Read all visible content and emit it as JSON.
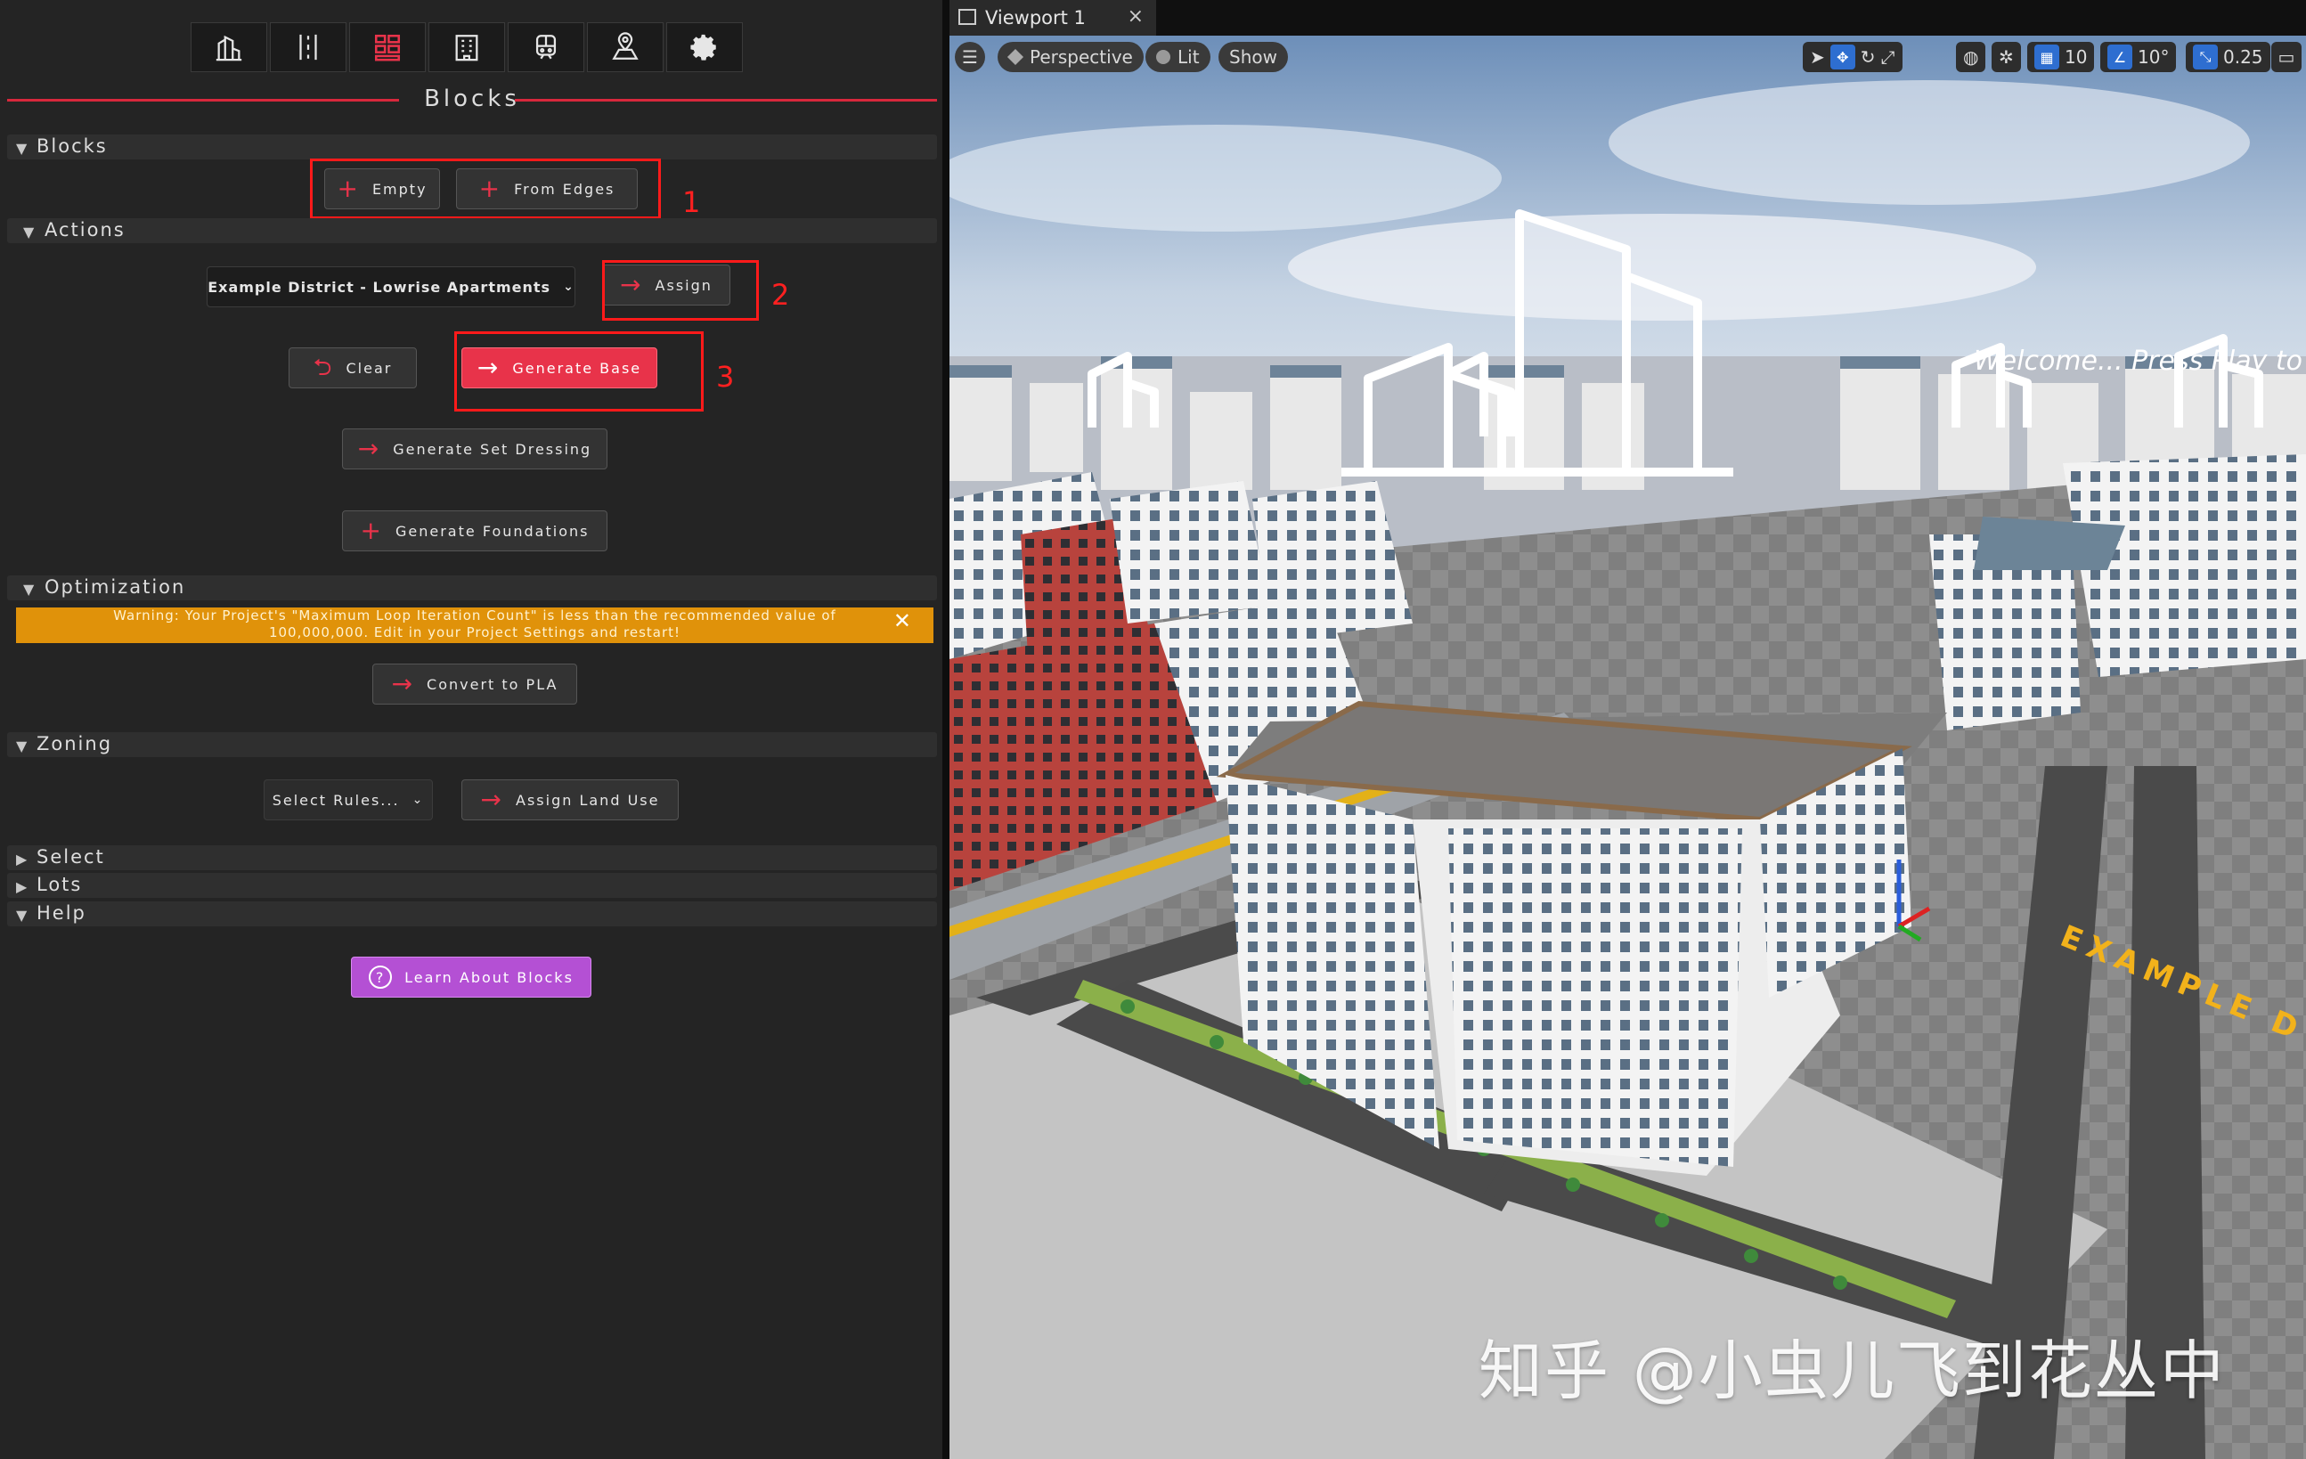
{
  "toolbar": {
    "icons": [
      "buildings-icon",
      "road-icon",
      "blocks-icon",
      "building-icon",
      "transit-icon",
      "map-icon",
      "gear-icon"
    ],
    "active_index": 2
  },
  "panel_title": "Blocks",
  "sections": {
    "blocks": "Blocks",
    "actions": "Actions",
    "optimization": "Optimization",
    "zoning": "Zoning",
    "select": "Select",
    "lots": "Lots",
    "help": "Help"
  },
  "buttons": {
    "empty": "Empty",
    "from_edges": "From Edges",
    "district_dropdown": "Example District - Lowrise Apartments",
    "assign": "Assign",
    "clear": "Clear",
    "generate_base": "Generate Base",
    "generate_set_dressing": "Generate Set Dressing",
    "generate_foundations": "Generate Foundations",
    "convert_to_pla": "Convert to PLA",
    "select_rules": "Select Rules...",
    "assign_land_use": "Assign Land Use",
    "learn_about_blocks": "Learn About Blocks"
  },
  "annotations": [
    "1",
    "2",
    "3"
  ],
  "warning": {
    "line1": "Warning: Your Project's \"Maximum Loop Iteration Count\" is less than the recommended value of",
    "line2": "100,000,000. Edit in your Project Settings and restart!"
  },
  "viewport": {
    "tab_title": "Viewport 1",
    "perspective": "Perspective",
    "lit": "Lit",
    "show": "Show",
    "grid_snap": "10",
    "rotation_snap": "10°",
    "scale_snap": "0.25",
    "banner_text": "Welcome... Press Play to begin the walkthrough",
    "ground_text": "EXAMPLE D"
  },
  "watermark": "知乎 @小虫儿飞到花丛中",
  "colors": {
    "accent_red": "#e8334a",
    "warning_orange": "#e0920a",
    "help_purple": "#b450d4",
    "annotation_red": "#ff1a1a"
  }
}
